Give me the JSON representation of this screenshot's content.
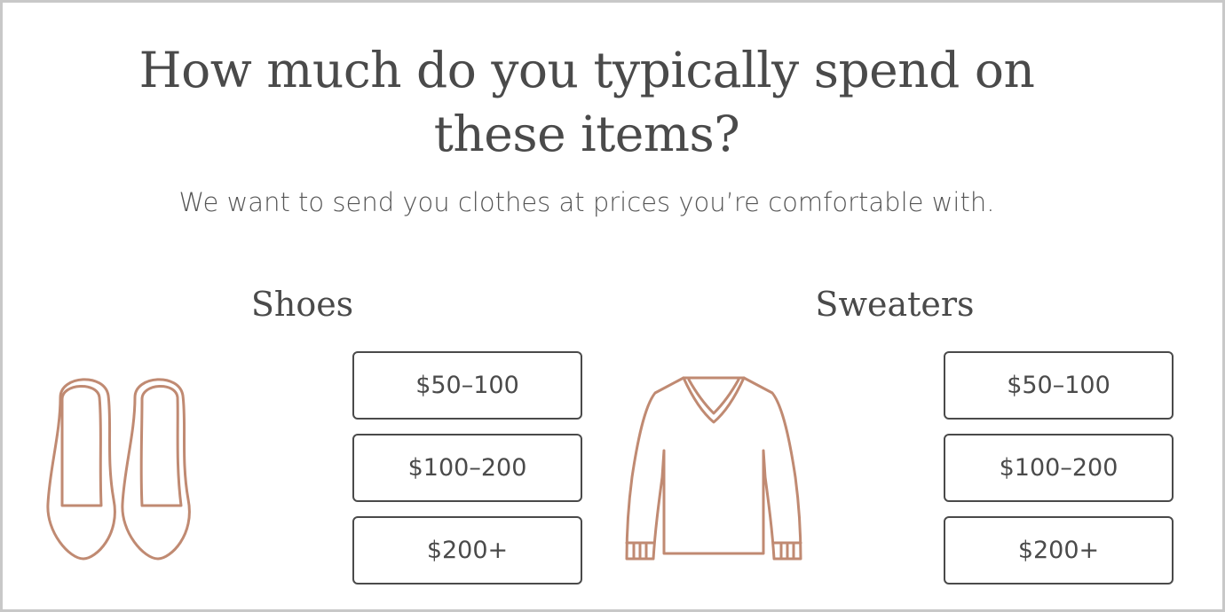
{
  "page": {
    "title_line1": "How much do you typically spend on",
    "title_line2": "these items?",
    "subtitle": "We want to send you clothes at prices you’re comfortable with."
  },
  "categories": [
    {
      "label": "Shoes",
      "icon": "shoes-icon",
      "options": [
        "$50–100",
        "$100–200",
        "$200+"
      ]
    },
    {
      "label": "Sweaters",
      "icon": "sweater-icon",
      "options": [
        "$50–100",
        "$100–200",
        "$200+"
      ]
    }
  ],
  "colors": {
    "illustration": "#c08a72",
    "text": "#4a4a4a",
    "border": "#4a4a4a",
    "frame": "#c8c8c8"
  }
}
